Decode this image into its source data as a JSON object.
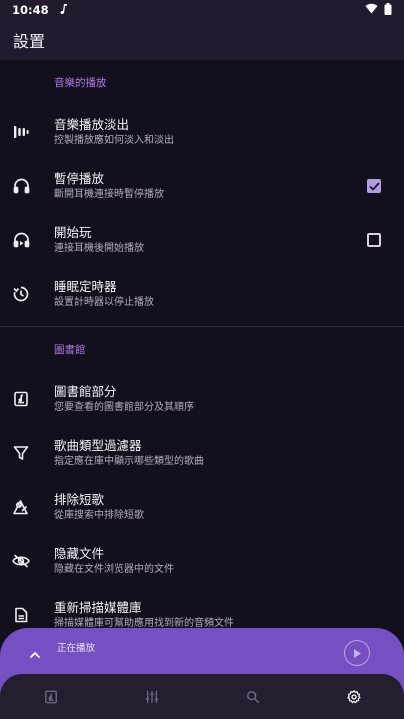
{
  "status_bar": {
    "time": "10:48",
    "app_icon": "music-note-icon"
  },
  "toolbar": {
    "title": "設置"
  },
  "sections": [
    {
      "header": "音樂的播放",
      "items": [
        {
          "icon": "fade-bars-icon",
          "title": "音樂播放淡出",
          "summary": "控製播放應如何淡入和淡出",
          "widget": "none"
        },
        {
          "icon": "headphones-icon",
          "title": "暫停播放",
          "summary": "斷開耳機連接時暫停播放",
          "widget": "checkbox",
          "checked": true
        },
        {
          "icon": "headphones-play-icon",
          "title": "開始玩",
          "summary": "連接耳機後開始播放",
          "widget": "checkbox",
          "checked": false
        },
        {
          "icon": "sleep-timer-icon",
          "title": "睡眠定時器",
          "summary": "設置計時器以停止播放",
          "widget": "none"
        }
      ]
    },
    {
      "header": "圖書館",
      "items": [
        {
          "icon": "library-icon",
          "title": "圖書館部分",
          "summary": "您要查看的圖書館部分及其順序",
          "widget": "none"
        },
        {
          "icon": "filter-icon",
          "title": "歌曲類型過濾器",
          "summary": "指定應在庫中顯示哪些類型的歌曲",
          "widget": "none"
        },
        {
          "icon": "exclude-short-icon",
          "title": "排除短歌",
          "summary": "從庫搜索中排除短歌",
          "widget": "none"
        },
        {
          "icon": "eye-off-icon",
          "title": "隐藏文件",
          "summary": "隐藏在文件浏览器中的文件",
          "widget": "none"
        },
        {
          "icon": "rescan-file-icon",
          "title": "重新掃描媒體庫",
          "summary": "掃描媒體庫可幫助應用找到新的音頻文件",
          "widget": "none"
        }
      ]
    }
  ],
  "mini_player": {
    "label": "正在播放",
    "expand_icon": "chevron-up-icon",
    "play_icon": "play-icon"
  },
  "bottom_nav": [
    {
      "icon": "library-tab-icon",
      "active": false
    },
    {
      "icon": "equalizer-tab-icon",
      "active": false
    },
    {
      "icon": "search-tab-icon",
      "active": false
    },
    {
      "icon": "settings-tab-icon",
      "active": true
    }
  ],
  "colors": {
    "accent": "#a779e6",
    "player": "#7550c3",
    "background": "#140f1d",
    "bar": "#231b2d"
  }
}
